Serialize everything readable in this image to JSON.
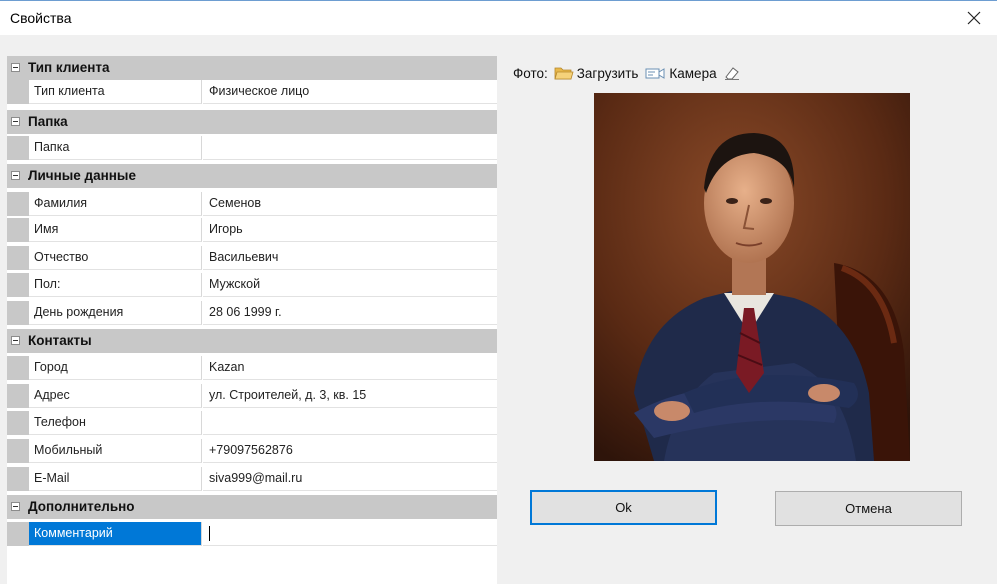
{
  "window": {
    "title": "Свойства"
  },
  "grid": {
    "categories": [
      {
        "label": "Тип клиента",
        "props": [
          {
            "name": "Тип клиента",
            "value": "Физическое лицо"
          }
        ]
      },
      {
        "label": "Папка",
        "props": [
          {
            "name": "Папка",
            "value": ""
          }
        ]
      },
      {
        "label": "Личные данные",
        "props": [
          {
            "name": "Фамилия",
            "value": "Семенов"
          },
          {
            "name": "Имя",
            "value": "Игорь"
          },
          {
            "name": "Отчество",
            "value": "Васильевич"
          },
          {
            "name": "Пол:",
            "value": "Мужской"
          },
          {
            "name": "День рождения",
            "value": "28 06 1999 г."
          }
        ]
      },
      {
        "label": "Контакты",
        "props": [
          {
            "name": "Город",
            "value": "Kazan"
          },
          {
            "name": "Адрес",
            "value": "ул. Строителей, д. 3, кв. 15"
          },
          {
            "name": "Телефон",
            "value": ""
          },
          {
            "name": "Мобильный",
            "value": "+79097562876"
          },
          {
            "name": "E-Mail",
            "value": "siva999@mail.ru"
          }
        ]
      },
      {
        "label": "Дополнительно",
        "props": [
          {
            "name": "Комментарий",
            "value": ""
          }
        ]
      }
    ]
  },
  "photo": {
    "label": "Фото:",
    "load_label": "Загрузить",
    "camera_label": "Камера",
    "icons": [
      "folder-icon",
      "camera-icon",
      "eraser-icon"
    ]
  },
  "buttons": {
    "ok": "Ok",
    "cancel": "Отмена"
  },
  "colors": {
    "selection": "#0078d7",
    "category_bg": "#c8c8c8",
    "window_bg": "#f0f0f0"
  }
}
